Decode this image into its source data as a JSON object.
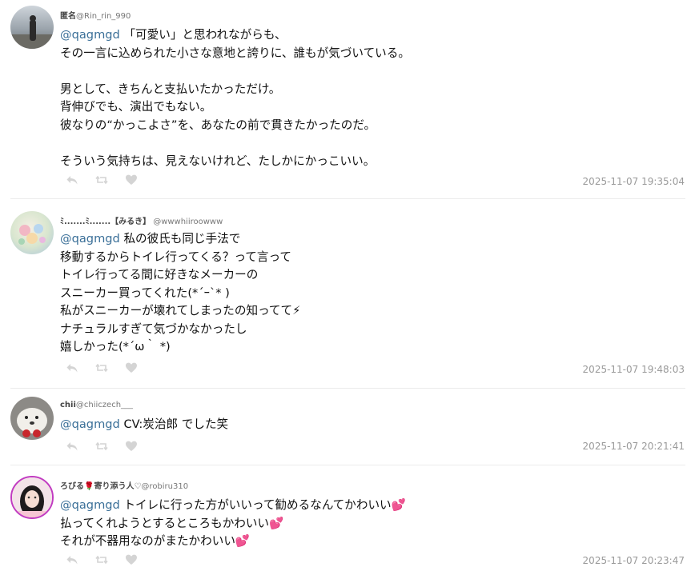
{
  "tweets": [
    {
      "display_name": "匿名",
      "handle": "@Rin_rin_990",
      "mention": "@qagmgd",
      "line1_rest": " 「可愛い」と思われながらも、",
      "lines": [
        "その一言に込められた小さな意地と誇りに、誰もが気づいている。",
        "",
        "男として、きちんと支払いたかっただけ。",
        "背伸びでも、演出でもない。",
        "彼なりの“かっこよさ”を、あなたの前で貫きたかったのだ。",
        "",
        "そういう気持ちは、見えないけれど、たしかにかっこいい。"
      ],
      "timestamp": "2025-11-07 19:35:04"
    },
    {
      "display_name": "ﾐ.......ﾐ.......【みるき】",
      "handle": "@wwwhiiroowww",
      "mention": "@qagmgd",
      "line1_rest": " 私の彼氏も同じ手法で",
      "lines": [
        "移動するからトイレ行ってくる？って言って",
        "トイレ行ってる間に好きなメーカーの",
        "スニーカー買ってくれた(*´ｰ`* )",
        "私がスニーカーが壊れてしまったの知ってて⚡︎",
        "ナチュラルすぎて気づかなかったし",
        "嬉しかった(*´ω｀ *)"
      ],
      "timestamp": "2025-11-07 19:48:03"
    },
    {
      "display_name": "chii",
      "handle": "@chiiczech___",
      "mention": "@qagmgd",
      "line1_rest": " CV:炭治郎 でした笑",
      "lines": [],
      "timestamp": "2025-11-07 20:21:41"
    },
    {
      "display_name": "ろびる🌹寄り添う人♡",
      "handle": "@robiru310",
      "mention": "@qagmgd",
      "line1_rest": " トイレに行った方がいいって勧めるなんてかわいい💕",
      "lines": [
        "払ってくれようとするところもかわいい💕",
        "それが不器用なのがまたかわいい💕"
      ],
      "timestamp": "2025-11-07 20:23:47"
    }
  ],
  "icons": {
    "reply": "reply-icon",
    "retweet": "retweet-icon",
    "like": "heart-icon"
  },
  "colors": {
    "mention": "#3a6f98",
    "timestamp": "#9a9a9a",
    "icon": "#d4d4d4",
    "separator": "#ececec",
    "avatar4_ring": "#c13bc1"
  }
}
